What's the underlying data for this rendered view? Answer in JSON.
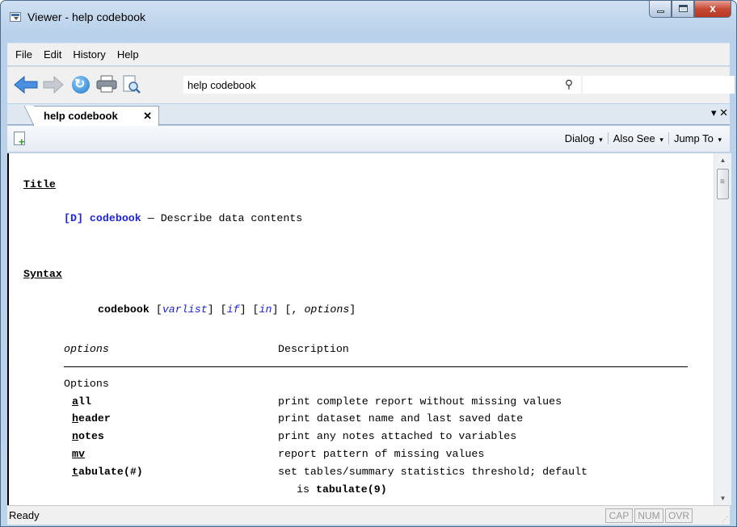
{
  "window": {
    "title": "Viewer - help codebook",
    "close_glyph": "x"
  },
  "menubar": {
    "items": [
      "File",
      "Edit",
      "History",
      "Help"
    ]
  },
  "toolbar": {
    "address": "help codebook"
  },
  "tab": {
    "label": "help codebook",
    "close": "✕",
    "menu": "▾ ✕"
  },
  "viewer_toolbar": {
    "dialog": "Dialog",
    "also_see": "Also See",
    "jump_to": "Jump To",
    "caret": "▾"
  },
  "help": {
    "title_heading": "Title",
    "title_ref": "[D] codebook",
    "title_desc": " — Describe data contents",
    "syntax_heading": "Syntax",
    "cmd": "codebook",
    "varlist": "varlist",
    "if": "if",
    "in": "in",
    "opt_tail": "[, ",
    "opt_word": "options",
    "opt_close": "]",
    "col_options": "options",
    "col_description": "Description",
    "group": "Options",
    "rows": [
      {
        "u": "a",
        "rest": "ll",
        "desc": "print complete report without missing values"
      },
      {
        "u": "h",
        "rest": "eader",
        "desc": "print dataset name and last saved date"
      },
      {
        "u": "n",
        "rest": "otes",
        "desc": "print any notes attached to variables"
      },
      {
        "u": "mv",
        "rest": "",
        "desc": "report pattern of missing values"
      },
      {
        "u": "t",
        "rest": "abulate(#)",
        "desc": "set tables/summary statistics threshold; default"
      }
    ],
    "cont_prefix": "is ",
    "cont_bold": "tabulate(9)"
  },
  "statusbar": {
    "status": "Ready",
    "cap": "CAP",
    "num": "NUM",
    "ovr": "OVR"
  }
}
